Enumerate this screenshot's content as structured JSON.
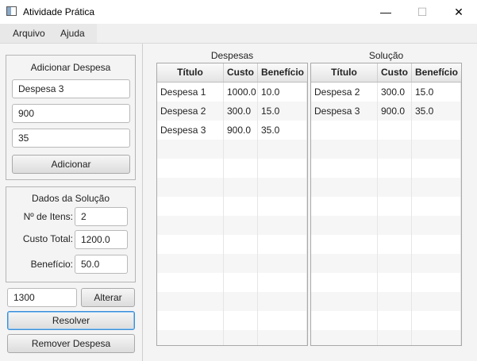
{
  "window": {
    "title": "Atividade Prática",
    "minimize_symbol": "—",
    "maximize_symbol": "☐",
    "close_symbol": "✕",
    "icon": "app-window-icon"
  },
  "menu": {
    "items": [
      "Arquivo",
      "Ajuda"
    ]
  },
  "add_expense": {
    "title": "Adicionar Despesa",
    "name_value": "Despesa 3",
    "cost_value": "900",
    "benefit_value": "35",
    "add_button": "Adicionar"
  },
  "solution_data": {
    "title": "Dados da Solução",
    "items_label": "Nº de Itens:",
    "items_value": "2",
    "total_cost_label": "Custo Total:",
    "total_cost_value": "1200.0",
    "benefit_label": "Benefício:",
    "benefit_value": "50.0"
  },
  "budget": {
    "value": "1300",
    "alter_button": "Alterar"
  },
  "actions": {
    "solve_button": "Resolver",
    "remove_button": "Remover Despesa"
  },
  "expenses_table": {
    "caption": "Despesas",
    "columns": [
      "Título",
      "Custo",
      "Benefício"
    ],
    "rows": [
      [
        "Despesa 1",
        "1000.0",
        "10.0"
      ],
      [
        "Despesa 2",
        "300.0",
        "15.0"
      ],
      [
        "Despesa 3",
        "900.0",
        "35.0"
      ]
    ]
  },
  "solution_table": {
    "caption": "Solução",
    "columns": [
      "Título",
      "Custo",
      "Benefício"
    ],
    "rows": [
      [
        "Despesa 2",
        "300.0",
        "15.0"
      ],
      [
        "Despesa 3",
        "900.0",
        "35.0"
      ]
    ]
  }
}
